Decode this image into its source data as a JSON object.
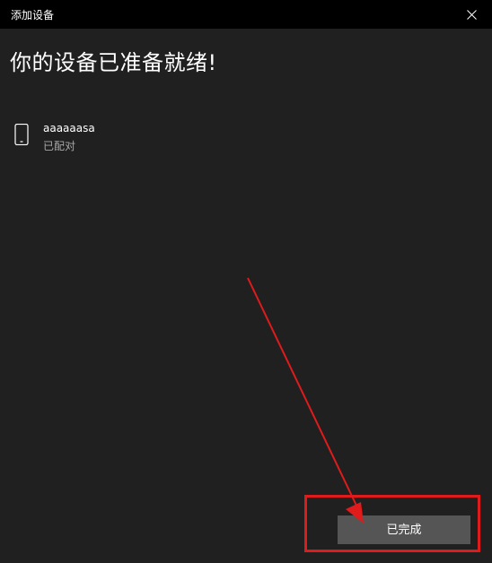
{
  "window": {
    "title": "添加设备"
  },
  "heading": "你的设备已准备就绪!",
  "device": {
    "name": "aaaaaasa",
    "status": "已配对",
    "icon": "phone-icon"
  },
  "actions": {
    "done_label": "已完成"
  },
  "colors": {
    "background": "#202020",
    "titlebar": "#000000",
    "button": "#555555",
    "annotation": "#e01b1b"
  }
}
